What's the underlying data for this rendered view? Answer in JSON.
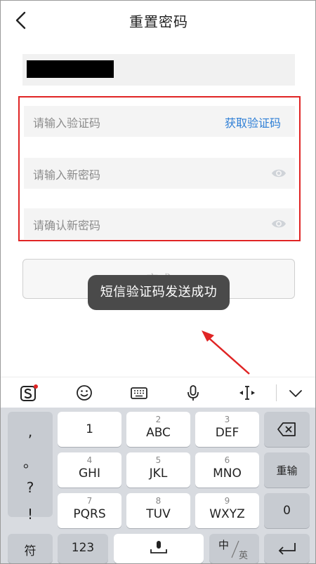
{
  "header": {
    "title": "重置密码"
  },
  "form": {
    "code_placeholder": "请输入验证码",
    "get_code_label": "获取验证码",
    "new_password_placeholder": "请输入新密码",
    "confirm_password_placeholder": "请确认新密码",
    "done_label": "完成"
  },
  "toast": {
    "message": "短信验证码发送成功"
  },
  "keyboard": {
    "punctuation": [
      ",",
      "。",
      "?",
      "!"
    ],
    "keys": {
      "k1": {
        "main": "1"
      },
      "k2": {
        "small": "2",
        "main": "ABC"
      },
      "k3": {
        "small": "3",
        "main": "DEF"
      },
      "k4": {
        "small": "4",
        "main": "GHI"
      },
      "k5": {
        "small": "5",
        "main": "JKL"
      },
      "k6": {
        "small": "6",
        "main": "MNO"
      },
      "k7": {
        "small": "7",
        "main": "PQRS"
      },
      "k8": {
        "small": "8",
        "main": "TUV"
      },
      "k9": {
        "small": "9",
        "main": "WXYZ"
      },
      "reinput": "重输",
      "zero": "0",
      "symbols": "符",
      "num123": "123",
      "lang_zh": "中",
      "lang_en": "英"
    }
  },
  "colors": {
    "accent": "#2f7fd6",
    "highlight_box": "#e02424",
    "toast_bg": "#4a4a4a",
    "keyboard_bg": "#d8dbe0"
  }
}
